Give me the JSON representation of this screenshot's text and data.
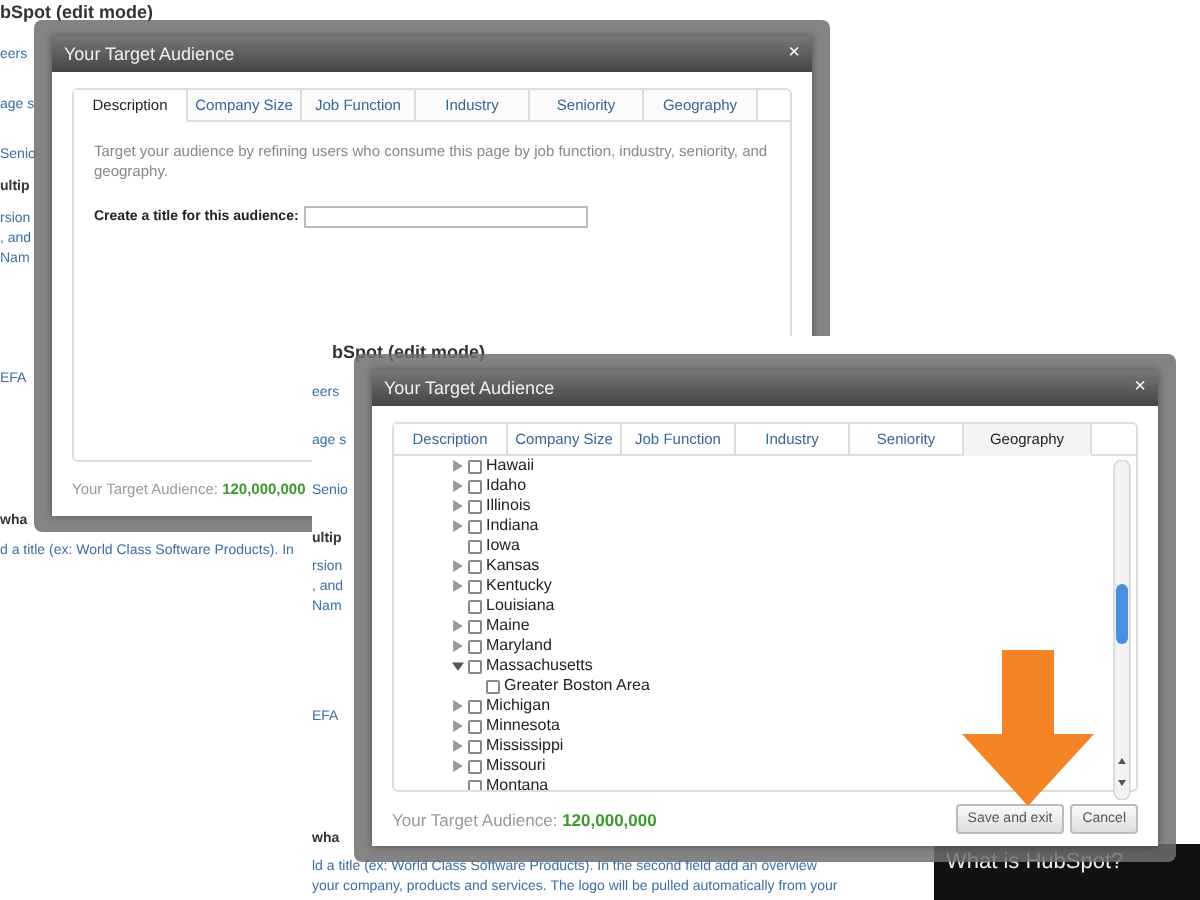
{
  "screenshots": [
    {
      "page_title": "bSpot (edit mode)",
      "fragments": [
        "eers",
        "age s",
        "Senio",
        "ultip",
        "rsion",
        ", and",
        "Nam",
        "EFA",
        "wha",
        "d a title (ex: World Class Software Products). In"
      ],
      "dialog": {
        "title": "Your Target Audience",
        "close": "×",
        "tabs": [
          {
            "label": "Description",
            "selected": true
          },
          {
            "label": "Company Size",
            "selected": false
          },
          {
            "label": "Job Function",
            "selected": false
          },
          {
            "label": "Industry",
            "selected": false
          },
          {
            "label": "Seniority",
            "selected": false
          },
          {
            "label": "Geography",
            "selected": false
          }
        ],
        "intro": "Target your audience by refining users who consume this page by job function, industry, seniority, and geography.",
        "field_label": "Create a title for this audience:",
        "audience_label": "Your Target Audience:",
        "audience_value": "120,000,000"
      }
    },
    {
      "page_title": "bSpot (edit mode)",
      "fragments": [
        "eers",
        "age s",
        "Senio",
        "ultip",
        "rsion",
        ", and",
        "Nam",
        "EFA",
        "wha",
        "ld a title (ex: World Class Software Products). In the second field add an overview",
        "your company, products and services. The logo will be pulled automatically from your"
      ],
      "dialog": {
        "title": "Your Target Audience",
        "close": "×",
        "tabs": [
          {
            "label": "Description",
            "selected": false
          },
          {
            "label": "Company Size",
            "selected": false
          },
          {
            "label": "Job Function",
            "selected": false
          },
          {
            "label": "Industry",
            "selected": false
          },
          {
            "label": "Seniority",
            "selected": false
          },
          {
            "label": "Geography",
            "selected": true
          }
        ],
        "tree": [
          {
            "label": "Hawaii",
            "expanded": false,
            "checked": false
          },
          {
            "label": "Idaho",
            "expanded": false,
            "checked": false
          },
          {
            "label": "Illinois",
            "expanded": false,
            "checked": false
          },
          {
            "label": "Indiana",
            "expanded": false,
            "checked": false
          },
          {
            "label": "Iowa",
            "checked": false
          },
          {
            "label": "Kansas",
            "expanded": false,
            "checked": false
          },
          {
            "label": "Kentucky",
            "expanded": false,
            "checked": false
          },
          {
            "label": "Louisiana",
            "checked": false
          },
          {
            "label": "Maine",
            "expanded": false,
            "checked": false
          },
          {
            "label": "Maryland",
            "expanded": false,
            "checked": false
          },
          {
            "label": "Massachusetts",
            "expanded": true,
            "checked": false,
            "children": [
              {
                "label": "Greater Boston Area",
                "checked": false
              }
            ]
          },
          {
            "label": "Michigan",
            "expanded": false,
            "checked": false
          },
          {
            "label": "Minnesota",
            "expanded": false,
            "checked": false
          },
          {
            "label": "Mississippi",
            "expanded": false,
            "checked": false
          },
          {
            "label": "Missouri",
            "expanded": false,
            "checked": false
          },
          {
            "label": "Montana",
            "checked": false
          }
        ],
        "audience_label": "Your Target Audience:",
        "audience_value": "120,000,000",
        "buttons": [
          "Save and exit",
          "Cancel"
        ]
      },
      "promo_title": "What is HubSpot?"
    }
  ]
}
